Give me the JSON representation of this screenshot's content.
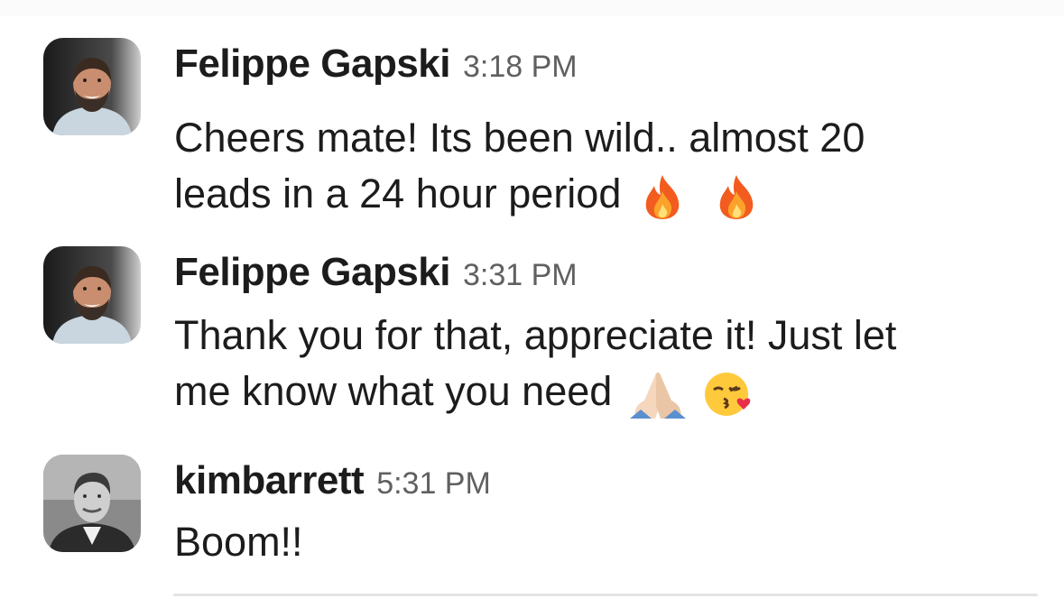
{
  "messages": [
    {
      "author": "Felippe Gapski",
      "time": "3:18 PM",
      "avatar_icon": "felippe-avatar",
      "lines": [
        "Cheers mate! Its been wild.. almost 20",
        "leads in a 24 hour period"
      ],
      "emojis": [
        "fire-emoji",
        "fire-emoji"
      ]
    },
    {
      "author": "Felippe Gapski",
      "time": "3:31 PM",
      "avatar_icon": "felippe-avatar",
      "lines": [
        "Thank you for that, appreciate it! Just let",
        "me know what you need"
      ],
      "emojis": [
        "folded-hands-emoji",
        "kissing-face-emoji"
      ]
    },
    {
      "author": "kimbarrett",
      "time": "5:31 PM",
      "avatar_icon": "kimbarrett-avatar",
      "lines": [
        "Boom!!"
      ],
      "emojis": []
    }
  ],
  "colors": {
    "author_text": "#1d1c1d",
    "timestamp_text": "#616061",
    "background": "#ffffff"
  }
}
